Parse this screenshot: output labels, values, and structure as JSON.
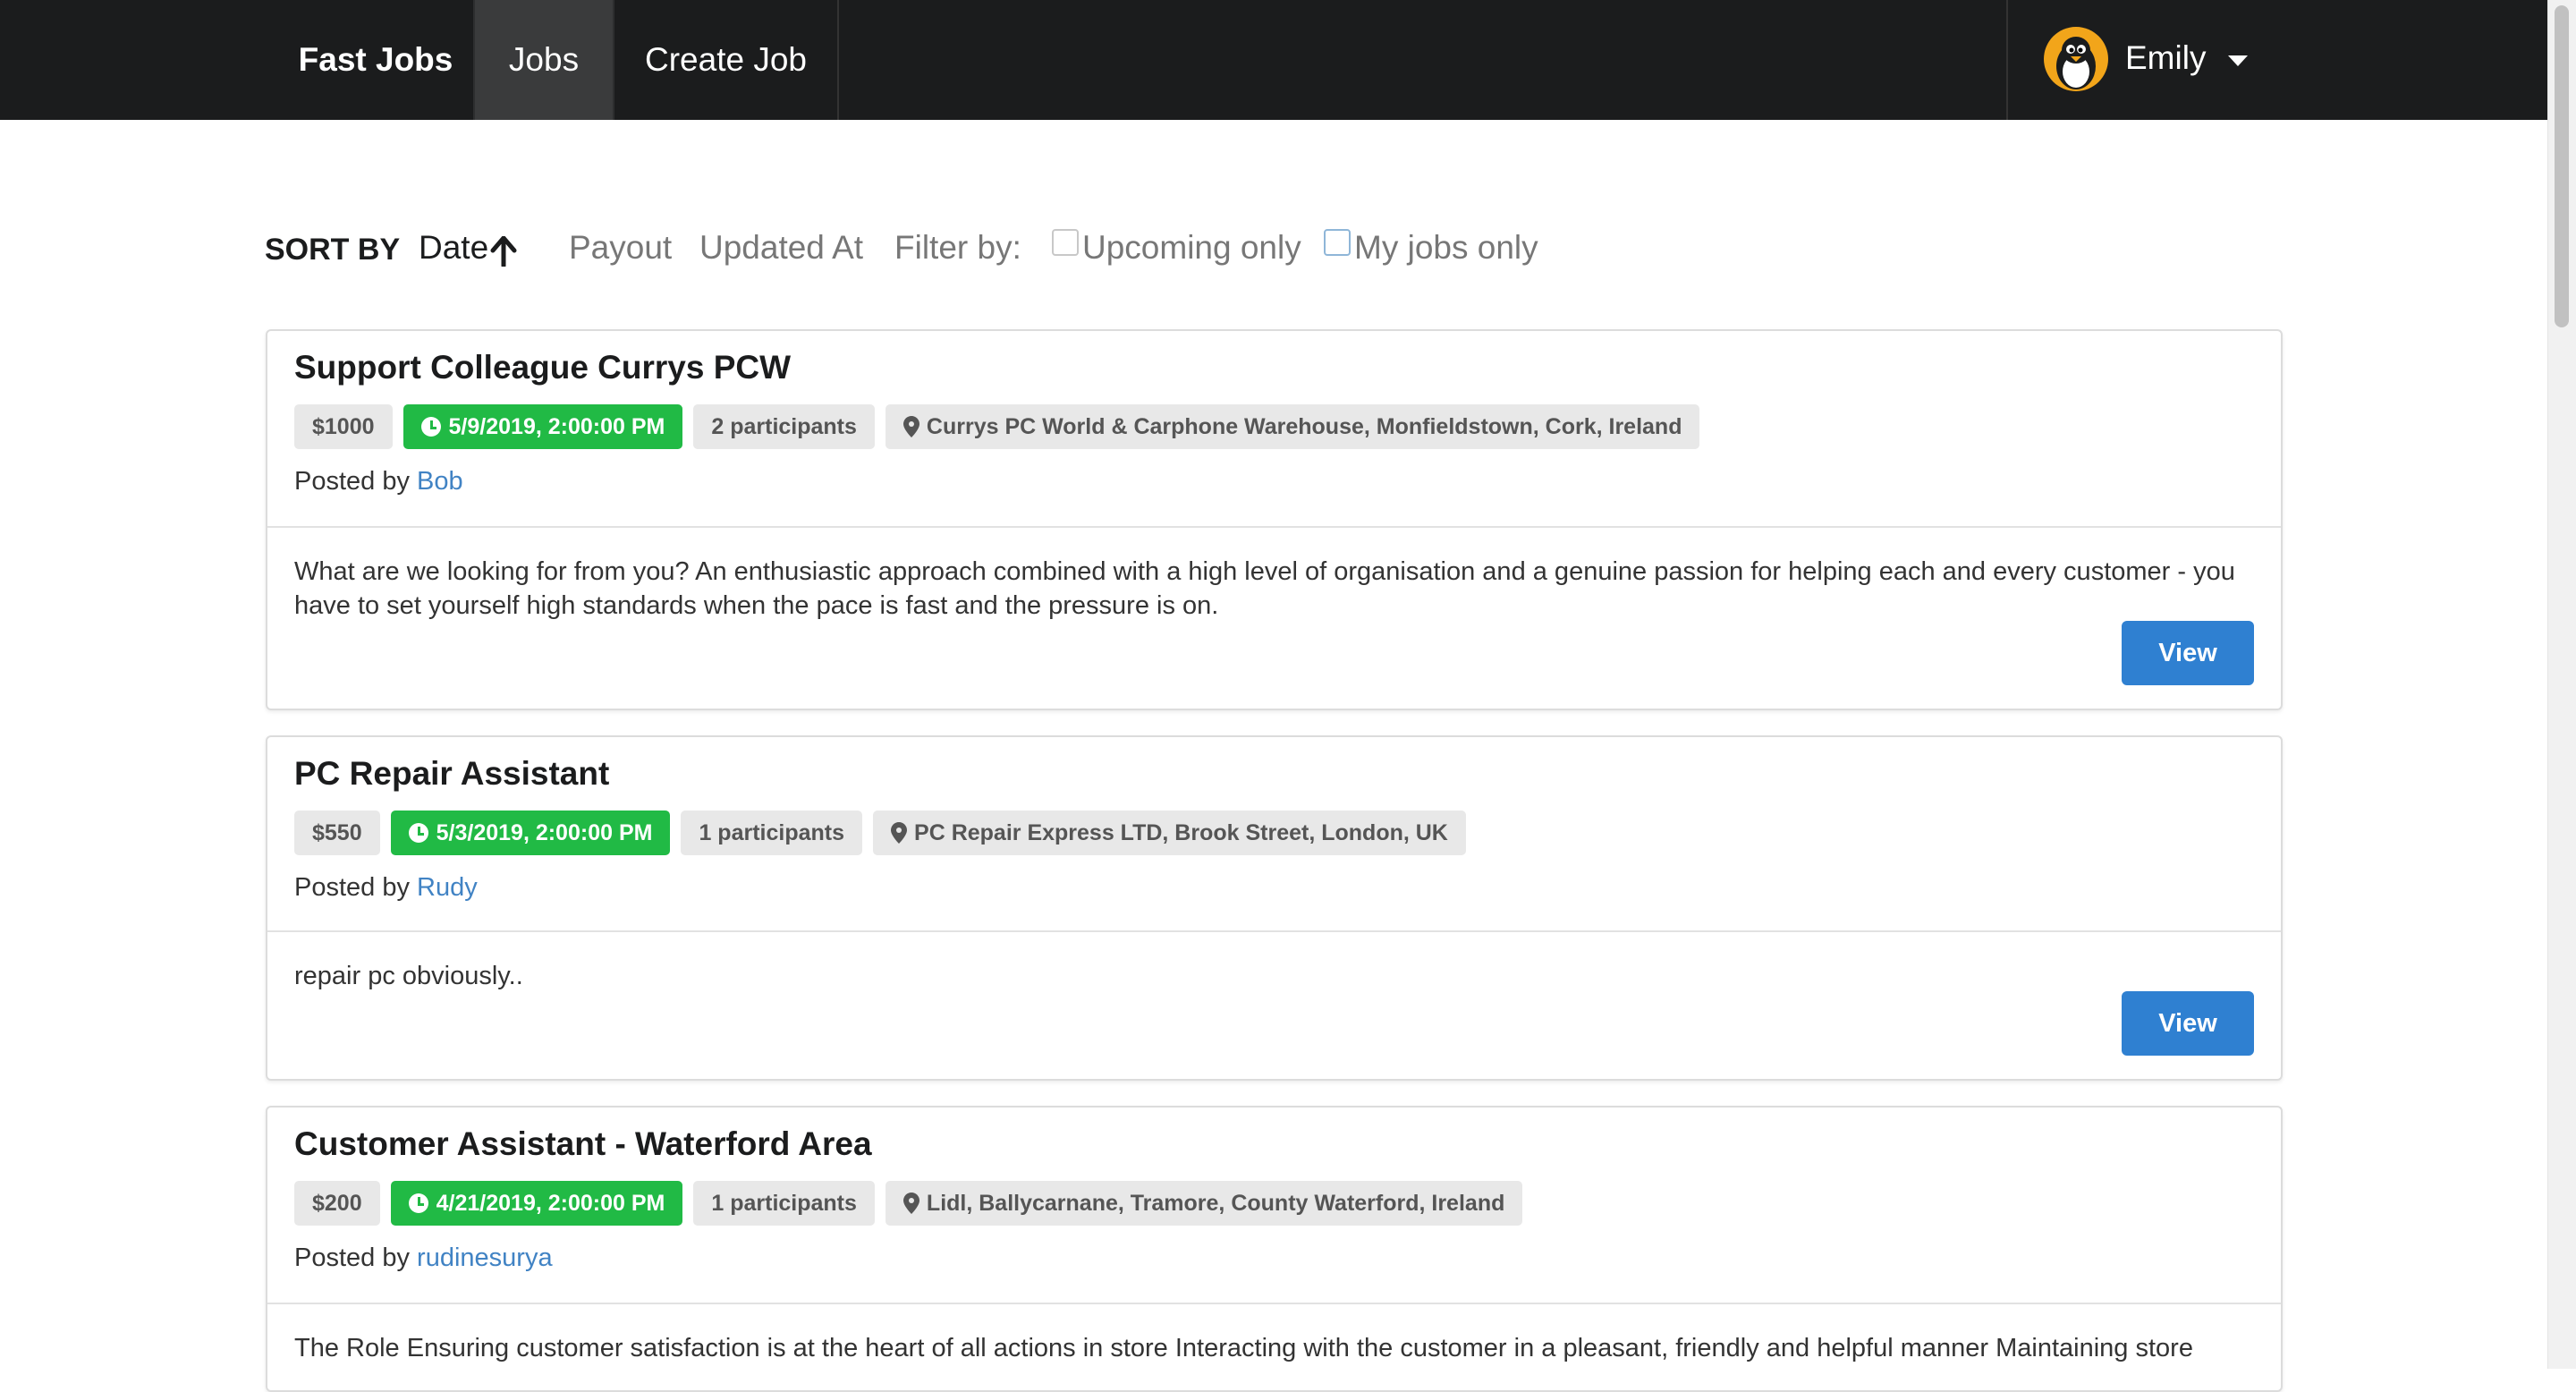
{
  "nav": {
    "brand": "Fast Jobs",
    "jobs": "Jobs",
    "create_job": "Create Job",
    "user_name": "Emily"
  },
  "sort": {
    "title": "SORT BY",
    "date": "Date",
    "payout": "Payout",
    "updated_at": "Updated At",
    "filter_label": "Filter by:",
    "upcoming_only": "Upcoming only",
    "my_jobs_only": "My jobs only"
  },
  "jobs": [
    {
      "title": "Support Colleague Currys PCW",
      "payout": "$1000",
      "date": "5/9/2019, 2:00:00 PM",
      "participants": "2 participants",
      "location": "Currys PC World & Carphone Warehouse, Monfieldstown, Cork, Ireland",
      "posted_by_prefix": "Posted by",
      "posted_by": "Bob",
      "description": "What are we looking for from you? An enthusiastic approach combined with a high level of organisation and a genuine passion for helping each and every customer - you have to set yourself high standards when the pace is fast and the pressure is on.",
      "view_label": "View"
    },
    {
      "title": "PC Repair Assistant",
      "payout": "$550",
      "date": "5/3/2019, 2:00:00 PM",
      "participants": "1 participants",
      "location": "PC Repair Express LTD, Brook Street, London, UK",
      "posted_by_prefix": "Posted by",
      "posted_by": "Rudy",
      "description": "repair pc obviously..",
      "view_label": "View"
    },
    {
      "title": "Customer Assistant - Waterford Area",
      "payout": "$200",
      "date": "4/21/2019, 2:00:00 PM",
      "participants": "1 participants",
      "location": "Lidl, Ballycarnane, Tramore, County Waterford, Ireland",
      "posted_by_prefix": "Posted by",
      "posted_by": "rudinesurya",
      "description": "The Role Ensuring customer satisfaction is at the heart of all actions in store Interacting with the customer in a pleasant, friendly and helpful manner Maintaining store",
      "view_label": "View"
    }
  ],
  "colors": {
    "navbar": "#1b1c1d",
    "active_tab": "#3a3b3c",
    "green_label": "#21ba45",
    "primary_button": "#2f80d1",
    "link": "#4183c4"
  },
  "icons": [
    "penguin-avatar-icon",
    "caret-down-icon",
    "arrow-up-icon",
    "clock-icon",
    "map-pin-icon"
  ]
}
